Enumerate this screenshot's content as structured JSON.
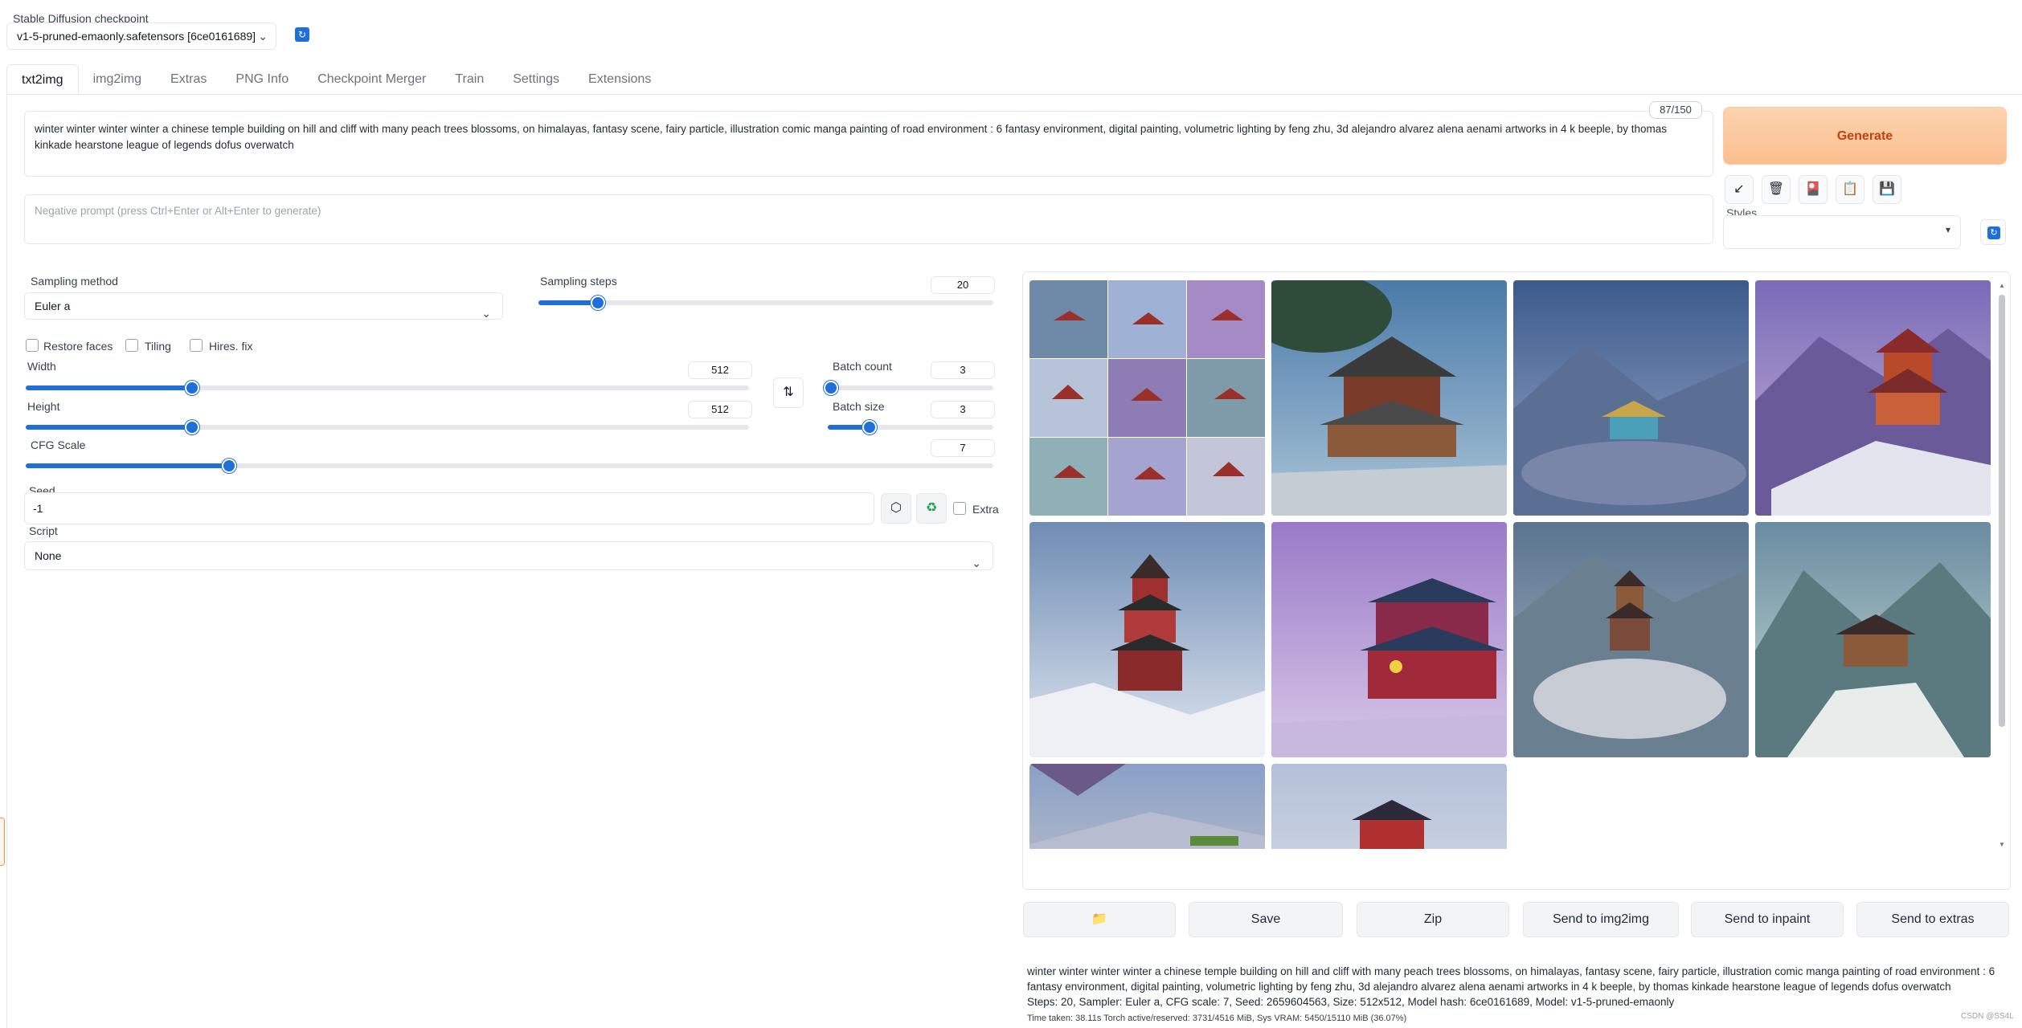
{
  "checkpoint": {
    "label": "Stable Diffusion checkpoint",
    "value": "v1-5-pruned-emaonly.safetensors [6ce0161689]"
  },
  "tabs": [
    {
      "label": "txt2img",
      "active": true
    },
    {
      "label": "img2img"
    },
    {
      "label": "Extras"
    },
    {
      "label": "PNG Info"
    },
    {
      "label": "Checkpoint Merger"
    },
    {
      "label": "Train"
    },
    {
      "label": "Settings"
    },
    {
      "label": "Extensions"
    }
  ],
  "prompt": {
    "value": "winter winter winter winter a chinese temple building on hill and cliff with many peach trees blossoms, on himalayas, fantasy scene, fairy particle, illustration comic manga painting of road environment : 6 fantasy environment, digital painting, volumetric lighting by feng zhu, 3d alejandro alvarez alena aenami artworks in 4 k beeple, by thomas kinkade hearstone league of legends dofus overwatch",
    "token_count": "87/150"
  },
  "negative_prompt": {
    "placeholder": "Negative prompt (press Ctrl+Enter or Alt+Enter to generate)"
  },
  "generate_label": "Generate",
  "tool_icons": [
    "arrow-icon",
    "trash-icon",
    "card-icon",
    "clipboard-icon",
    "save-icon"
  ],
  "styles": {
    "label": "Styles",
    "value": ""
  },
  "sampling": {
    "method_label": "Sampling method",
    "method_value": "Euler a",
    "steps_label": "Sampling steps",
    "steps_value": "20",
    "steps_fraction": 0.13
  },
  "checkboxes": {
    "restore_faces": "Restore faces",
    "tiling": "Tiling",
    "hires_fix": "Hires. fix"
  },
  "width": {
    "label": "Width",
    "value": "512",
    "fraction": 0.23
  },
  "height": {
    "label": "Height",
    "value": "512",
    "fraction": 0.23
  },
  "batch_count": {
    "label": "Batch count",
    "value": "3",
    "fraction": 0.02
  },
  "batch_size": {
    "label": "Batch size",
    "value": "3",
    "fraction": 0.25
  },
  "cfg": {
    "label": "CFG Scale",
    "value": "7",
    "fraction": 0.21
  },
  "seed": {
    "label": "Seed",
    "value": "-1",
    "extra_label": "Extra"
  },
  "script": {
    "label": "Script",
    "value": "None"
  },
  "actions": {
    "folder_icon": "folder-icon",
    "save": "Save",
    "zip": "Zip",
    "send_img2img": "Send to img2img",
    "send_inpaint": "Send to inpaint",
    "send_extras": "Send to extras"
  },
  "info": {
    "prompt_text": "winter winter winter winter a chinese temple building on hill and cliff with many peach trees blossoms, on himalayas, fantasy scene, fairy particle, illustration comic manga painting of road environment : 6 fantasy environment, digital painting, volumetric lighting by feng zhu, 3d alejandro alvarez alena aenami artworks in 4 k beeple, by thomas kinkade hearstone league of legends dofus overwatch",
    "params": "Steps: 20, Sampler: Euler a, CFG scale: 7, Seed: 2659604563, Size: 512x512, Model hash: 6ce0161689, Model: v1-5-pruned-emaonly",
    "timing": "Time taken: 38.11s  Torch active/reserved: 3731/4516 MiB, Sys VRAM: 5450/15110 MiB (36.07%)"
  },
  "watermark": "CSDN @SS4L",
  "colors": {
    "accent": "#1e6fd9",
    "generate": "#fbbf8e"
  }
}
